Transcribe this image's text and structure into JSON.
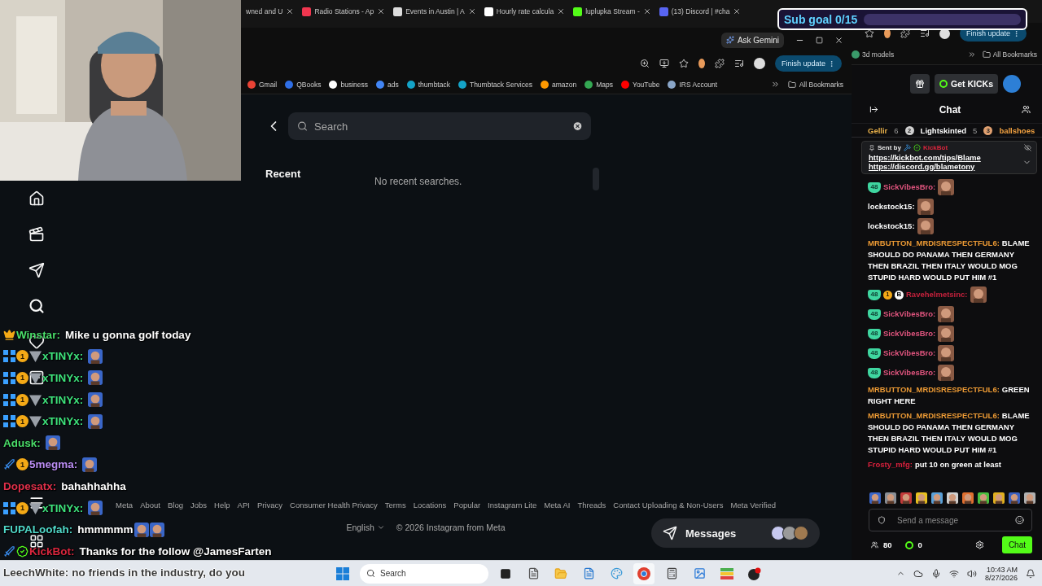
{
  "browser": {
    "tabs": [
      {
        "title": "wned and U"
      },
      {
        "title": "Radio Stations - Ap"
      },
      {
        "title": "Events in Austin | A"
      },
      {
        "title": "Hourly rate calcula"
      },
      {
        "title": "luplupka Stream -"
      },
      {
        "title": "(13) Discord | #cha"
      }
    ],
    "ask_gemini": "Ask Gemini",
    "finish_update": "Finish update",
    "bookmarks": [
      {
        "label": "Gmail"
      },
      {
        "label": "QBooks"
      },
      {
        "label": "business"
      },
      {
        "label": "ads"
      },
      {
        "label": "thumbtack"
      },
      {
        "label": "Thumbtack Services"
      },
      {
        "label": "amazon"
      },
      {
        "label": "Maps"
      },
      {
        "label": "YouTube"
      },
      {
        "label": "IRS Account"
      }
    ],
    "all_bookmarks": "All Bookmarks"
  },
  "instagram": {
    "search": {
      "placeholder": "Search"
    },
    "recent_heading": "Recent",
    "empty_text": "No recent searches.",
    "footer_links": [
      "Meta",
      "About",
      "Blog",
      "Jobs",
      "Help",
      "API",
      "Privacy",
      "Consumer Health Privacy",
      "Terms",
      "Locations",
      "Popular",
      "Instagram Lite",
      "Meta AI",
      "Threads",
      "Contact Uploading & Non-Users",
      "Meta Verified"
    ],
    "language": "English",
    "copyright": "© 2026 Instagram from Meta",
    "messages": "Messages"
  },
  "stream_overlay": {
    "chat": [
      {
        "badges": [
          {
            "kind": "crown"
          }
        ],
        "user": "Winstar:",
        "color": "#4ade6a",
        "text": "Mike u gonna golf today"
      },
      {
        "badges": [
          {
            "kind": "pixel"
          },
          {
            "kind": "coin",
            "label": "1"
          },
          {
            "kind": "fin"
          }
        ],
        "user": "xTINYx:",
        "color": "#3ee27c",
        "emotes": [
          {
            "kind": "picture"
          }
        ]
      },
      {
        "badges": [
          {
            "kind": "pixel"
          },
          {
            "kind": "coin",
            "label": "1"
          },
          {
            "kind": "fin"
          }
        ],
        "user": "xTINYx:",
        "color": "#3ee27c",
        "emotes": [
          {
            "kind": "picture"
          }
        ]
      },
      {
        "badges": [
          {
            "kind": "pixel"
          },
          {
            "kind": "coin",
            "label": "1"
          },
          {
            "kind": "fin"
          }
        ],
        "user": "xTINYx:",
        "color": "#3ee27c",
        "emotes": [
          {
            "kind": "picture"
          }
        ]
      },
      {
        "badges": [
          {
            "kind": "pixel"
          },
          {
            "kind": "coin",
            "label": "1"
          },
          {
            "kind": "fin"
          }
        ],
        "user": "xTINYx:",
        "color": "#3ee27c",
        "emotes": [
          {
            "kind": "picture"
          }
        ]
      },
      {
        "user": "Adusk:",
        "color": "#4ade6a",
        "emotes": [
          {
            "kind": "picture"
          }
        ]
      },
      {
        "badges": [
          {
            "kind": "sword"
          },
          {
            "kind": "coin",
            "label": "1"
          }
        ],
        "user": "5megma:",
        "color": "#b98cf2",
        "emotes": [
          {
            "kind": "picture"
          }
        ]
      },
      {
        "user": "Dopesatx:",
        "color": "#e0304a",
        "text": "bahahhahha"
      },
      {
        "badges": [
          {
            "kind": "pixel"
          },
          {
            "kind": "coin",
            "label": "1"
          },
          {
            "kind": "fin"
          }
        ],
        "user": "xTINYx:",
        "color": "#3ee27c",
        "emotes": [
          {
            "kind": "picture"
          }
        ]
      },
      {
        "user": "FUPALoofah:",
        "color": "#4fd8c8",
        "text": "hmmmmm",
        "emotes": [
          {
            "kind": "picture"
          },
          {
            "kind": "picture"
          }
        ]
      },
      {
        "badges": [
          {
            "kind": "sword"
          },
          {
            "kind": "verified"
          }
        ],
        "user": "KickBot:",
        "color": "#d9263d",
        "text": "Thanks for the follow @JamesFarten"
      }
    ],
    "bottom_message": {
      "user": "LeechWhite:",
      "text": "no friends in the industry, do you"
    }
  },
  "sub_goal": {
    "label": "Sub goal 0/15",
    "level": 0
  },
  "kick_window": {
    "bookmark": "3d models",
    "all_bookmarks": "All Bookmarks",
    "finish_update": "Finish update"
  },
  "kick": {
    "get_kicks": "Get KICKs",
    "title": "Chat",
    "leaderboard": [
      {
        "name": "Gellir",
        "count": "6",
        "color": "#e8b04a"
      },
      {
        "rank": "2",
        "name": "Lightskinted",
        "count": "5",
        "color": "#ffffff"
      },
      {
        "rank": "3",
        "name": "ballshoes",
        "color": "#f0a040"
      }
    ],
    "pinned": {
      "sent_by": "Sent by",
      "user": "KickBot",
      "links": [
        "https://kickbot.com/tips/Blame",
        "https://discord.gg/blametony"
      ]
    },
    "messages": [
      {
        "badges": [
          {
            "kind": "sub",
            "label": "48"
          }
        ],
        "user": "SickVibesBro:",
        "color": "#e2557f",
        "emotes": [
          {
            "kind": "picture"
          }
        ]
      },
      {
        "user": "lockstock15:",
        "color": "#ffffff",
        "emotes": [
          {
            "kind": "picture"
          }
        ]
      },
      {
        "user": "lockstock15:",
        "color": "#ffffff",
        "emotes": [
          {
            "kind": "picture"
          }
        ]
      },
      {
        "user": "MRBUTTON_MRDISRESPECTFUL6:",
        "color": "#ec9a34",
        "text": "BLAME SHOULD DO PANAMA THEN GERMANY THEN BRAZIL THEN ITALY WOULD MOG STUPID HARD WOULD PUT HIM #1"
      },
      {
        "badges": [
          {
            "kind": "sub",
            "label": "48"
          },
          {
            "kind": "coin",
            "label": "1"
          },
          {
            "kind": "letter",
            "label": "B"
          }
        ],
        "user": "Ravehelmetsinc:",
        "color": "#c4213c",
        "emotes": [
          {
            "kind": "picture"
          }
        ]
      },
      {
        "badges": [
          {
            "kind": "sub",
            "label": "48"
          }
        ],
        "user": "SickVibesBro:",
        "color": "#e2557f",
        "emotes": [
          {
            "kind": "picture"
          }
        ]
      },
      {
        "badges": [
          {
            "kind": "sub",
            "label": "48"
          }
        ],
        "user": "SickVibesBro:",
        "color": "#e2557f",
        "emotes": [
          {
            "kind": "picture"
          }
        ]
      },
      {
        "badges": [
          {
            "kind": "sub",
            "label": "48"
          }
        ],
        "user": "SickVibesBro:",
        "color": "#e2557f",
        "emotes": [
          {
            "kind": "picture"
          }
        ]
      },
      {
        "badges": [
          {
            "kind": "sub",
            "label": "48"
          }
        ],
        "user": "SickVibesBro:",
        "color": "#e2557f",
        "emotes": [
          {
            "kind": "picture"
          }
        ]
      },
      {
        "user": "MRBUTTON_MRDISRESPECTFUL6:",
        "color": "#ec9a34",
        "text": "GREEN RIGHT HERE"
      },
      {
        "user": "MRBUTTON_MRDISRESPECTFUL6:",
        "color": "#ec9a34",
        "text": "BLAME SHOULD DO PANAMA THEN GERMANY THEN BRAZIL THEN ITALY WOULD MOG STUPID HARD WOULD PUT HIM #1"
      },
      {
        "user": "Frosty_mfg:",
        "color": "#d8203c",
        "text": "put 10 on green at least"
      }
    ],
    "input": {
      "placeholder": "Send a message"
    },
    "viewers": "80",
    "kicks": "0",
    "chat_button": "Chat"
  },
  "taskbar": {
    "search": "Search",
    "time": "10:43 AM",
    "date": "8/27/2026"
  }
}
